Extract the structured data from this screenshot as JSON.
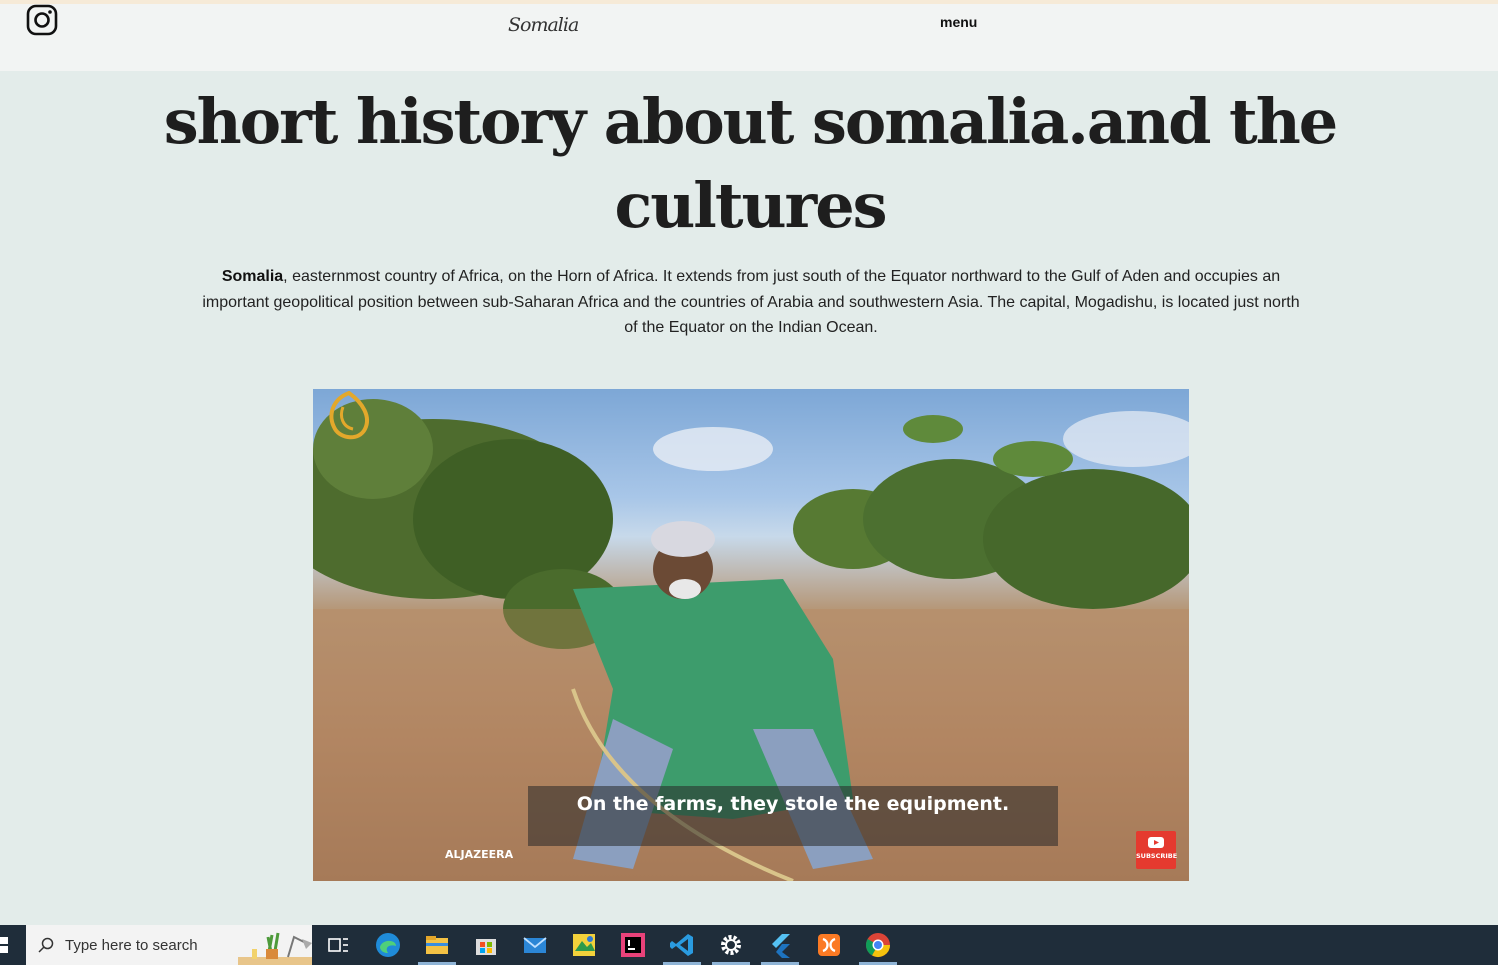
{
  "nav": {
    "logo": "Somalia",
    "menu_label": "menu"
  },
  "main": {
    "title": "short history about somalia.and the cultures",
    "intro_bold": "Somalia",
    "intro_rest": ", easternmost country of Africa, on the Horn of Africa. It extends from just south of the Equator northward to the Gulf of Aden and occupies an important geopolitical position between sub-Saharan Africa and the countries of Arabia and southwestern Asia. The capital, Mogadishu, is located just north of the Equator on the Indian Ocean."
  },
  "video": {
    "caption": "On the farms, they stole the equipment.",
    "channel": "ALJAZEERA",
    "subscribe_label": "SUBSCRIBE"
  },
  "taskbar": {
    "search_placeholder": "Type here to search",
    "apps": [
      "task-view",
      "edge",
      "file-explorer",
      "microsoft-store",
      "mail",
      "photos-editor",
      "intellij",
      "vscode",
      "settings",
      "flutter",
      "xampp",
      "chrome"
    ]
  },
  "colors": {
    "page_bg": "#e3ecea",
    "nav_bg": "#f2f4f3",
    "taskbar_bg": "#1f2d3a",
    "subscribe_red": "#e53a2f"
  }
}
